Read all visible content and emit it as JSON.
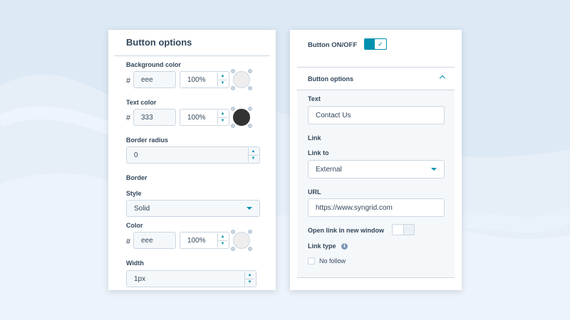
{
  "colors": {
    "accent": "#0091ae",
    "text": "#33475b",
    "border": "#cbd6e2",
    "field_bg": "#f5f8fa",
    "swatch_light": "#eeeeee",
    "swatch_dark": "#333333"
  },
  "left": {
    "title": "Button options",
    "background_color": {
      "label": "Background color",
      "hash": "#",
      "hex": "eee",
      "opacity": "100%"
    },
    "text_color": {
      "label": "Text color",
      "hash": "#",
      "hex": "333",
      "opacity": "100%"
    },
    "border_radius": {
      "label": "Border radius",
      "value": "0"
    },
    "border": {
      "label": "Border",
      "style_label": "Style",
      "style_value": "Solid",
      "color_label": "Color",
      "hash": "#",
      "hex": "eee",
      "opacity": "100%",
      "width_label": "Width",
      "width_value": "1px"
    }
  },
  "right": {
    "toggle_label": "Button ON/OFF",
    "toggle_on": true,
    "section_title": "Button options",
    "text_label": "Text",
    "text_value": "Contact Us",
    "link_heading": "Link",
    "link_to_label": "Link to",
    "link_to_value": "External",
    "url_label": "URL",
    "url_value": "https://www.syngrid.com",
    "new_window_label": "Open link in new window",
    "new_window_on": false,
    "link_type_label": "Link type",
    "no_follow_label": "No follow",
    "no_follow_checked": false
  },
  "icons": {
    "stepper_up": "▲",
    "stepper_down": "▼",
    "check": "✓",
    "info": "i"
  }
}
